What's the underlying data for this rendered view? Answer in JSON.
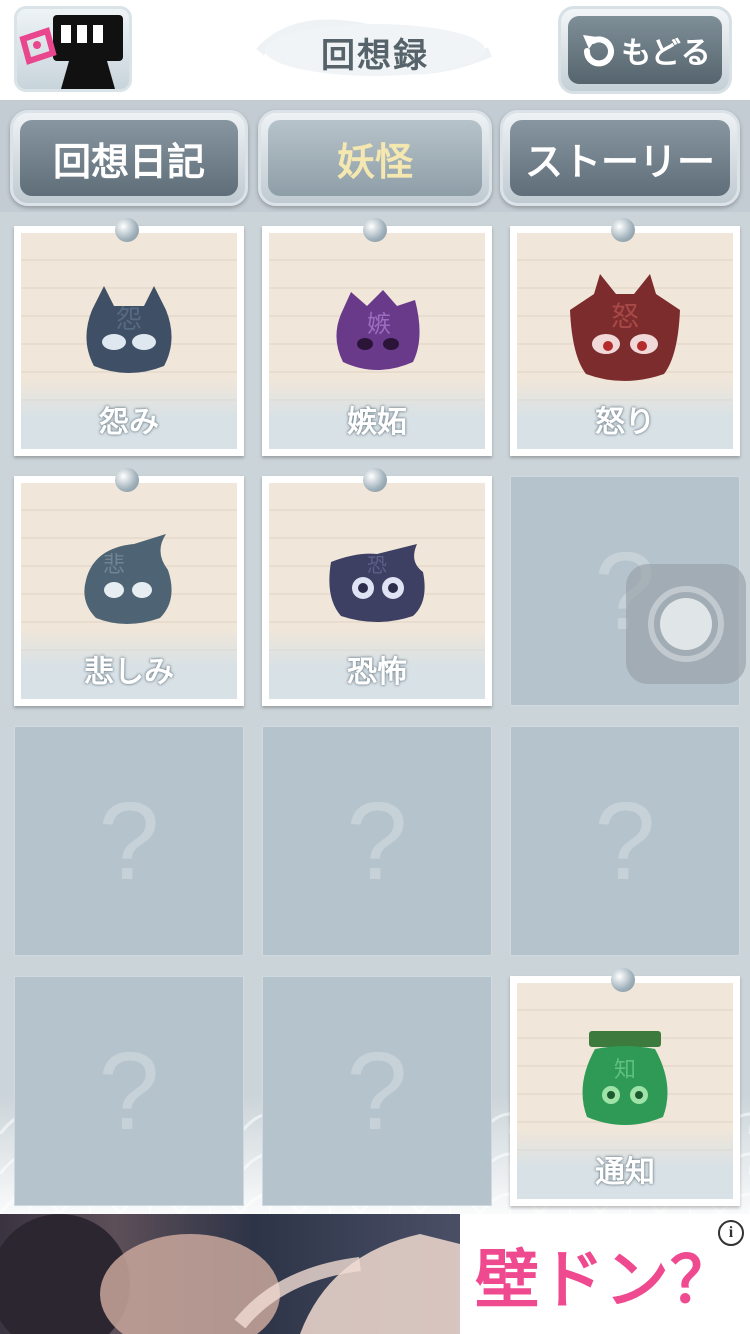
{
  "header": {
    "title": "回想録",
    "back_label": "もどる"
  },
  "tabs": [
    {
      "label": "回想日記",
      "active": false
    },
    {
      "label": "妖怪",
      "active": true
    },
    {
      "label": "ストーリー",
      "active": false
    }
  ],
  "cards": [
    {
      "name": "怨み",
      "unlocked": true,
      "color": "#3f5066",
      "kanji": "怨"
    },
    {
      "name": "嫉妬",
      "unlocked": true,
      "color": "#6a3a8a",
      "kanji": "嫉"
    },
    {
      "name": "怒り",
      "unlocked": true,
      "color": "#7c2c2c",
      "kanji": "怒"
    },
    {
      "name": "悲しみ",
      "unlocked": true,
      "color": "#4e6373",
      "kanji": "悲"
    },
    {
      "name": "恐怖",
      "unlocked": true,
      "color": "#3d3f63",
      "kanji": "恐"
    },
    {
      "name": "",
      "unlocked": false,
      "placeholder": "?"
    },
    {
      "name": "",
      "unlocked": false,
      "placeholder": "?"
    },
    {
      "name": "",
      "unlocked": false,
      "placeholder": "?"
    },
    {
      "name": "",
      "unlocked": false,
      "placeholder": "?"
    },
    {
      "name": "",
      "unlocked": false,
      "placeholder": "?"
    },
    {
      "name": "",
      "unlocked": false,
      "placeholder": "?"
    },
    {
      "name": "通知",
      "unlocked": true,
      "color": "#2f9a55",
      "kanji": "知"
    }
  ],
  "ad": {
    "text": "壁ドン？",
    "info": "i"
  },
  "icons": {
    "back": "undo-arrow-icon",
    "logo": "app-logo-icon",
    "assistive": "assistive-touch-icon"
  }
}
